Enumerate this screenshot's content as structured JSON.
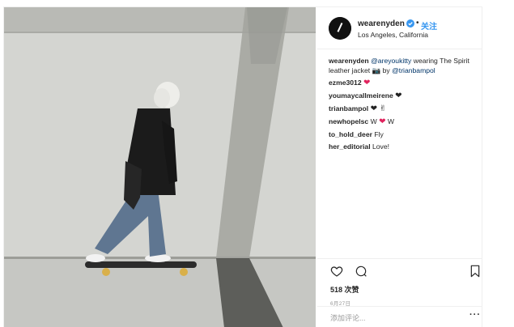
{
  "post": {
    "username": "wearenyden",
    "dot": "•",
    "follow_label": "关注",
    "location": "Los Angeles, California"
  },
  "caption": {
    "username": "wearenyden",
    "mention1": "@areyoukitty",
    "text1": " wearing The Spirit leather jacket ",
    "camera_emoji": "📷",
    "text2": " by ",
    "mention2": "@trianbampol"
  },
  "comments": [
    {
      "user": "ezme3012",
      "text": "",
      "emoji": "❤",
      "emoji_color": "red"
    },
    {
      "user": "youmaycallmeirene",
      "text": "",
      "emoji": "❤",
      "emoji_color": "black"
    },
    {
      "user": "trianbampol",
      "text": "",
      "emoji": "❤ ✌",
      "emoji_color": "black"
    },
    {
      "user": "newhopelsc",
      "text": "W ",
      "emoji": "❤",
      "emoji_color": "red",
      "text_after": " W"
    },
    {
      "user": "to_hold_deer",
      "text": "Fly",
      "emoji": "",
      "emoji_color": ""
    },
    {
      "user": "her_editorial",
      "text": "Love!",
      "emoji": "",
      "emoji_color": ""
    }
  ],
  "actions": {
    "like_icon": "heart-outline-icon",
    "comment_icon": "speech-bubble-icon",
    "save_icon": "bookmark-icon"
  },
  "likes": "518 次赞",
  "date": "6月27日",
  "add_comment_placeholder": "添加评论...",
  "more_label": "···",
  "colors": {
    "link_blue": "#3897f0",
    "mention_blue": "#003569",
    "heart_red": "#e0245e",
    "border": "#efefef"
  }
}
